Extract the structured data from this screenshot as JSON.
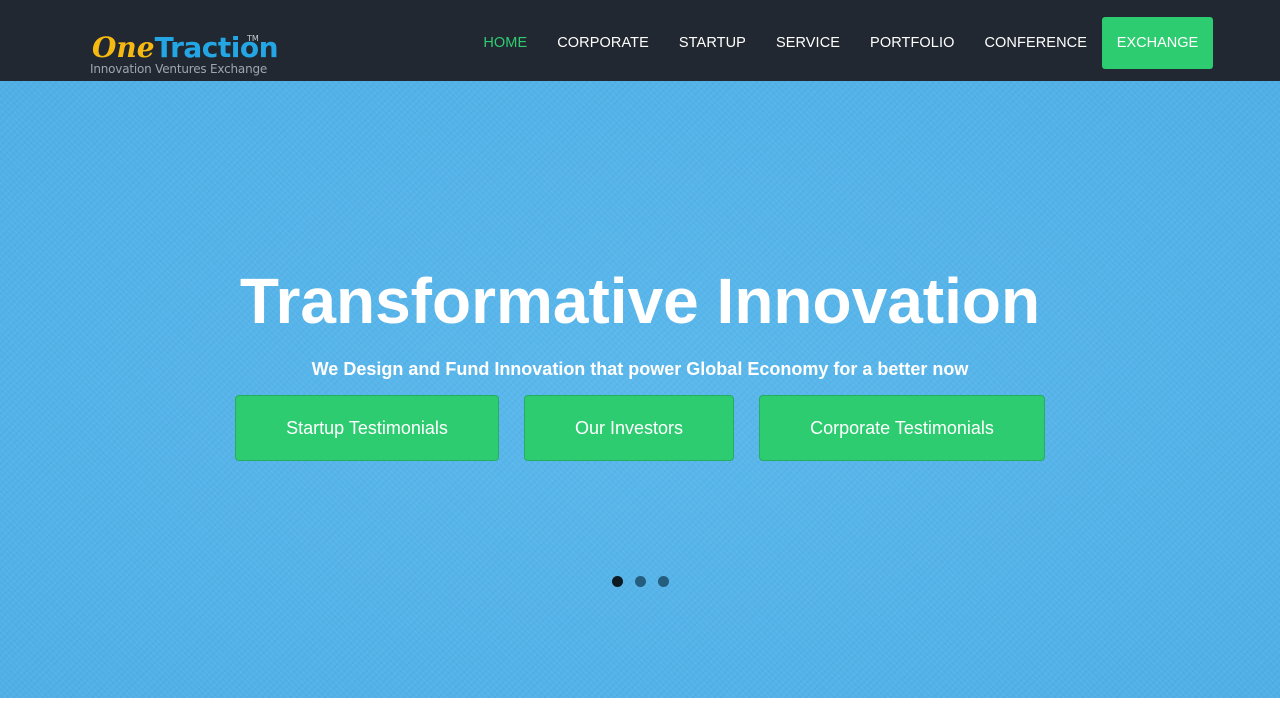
{
  "brand": {
    "logo_part1": "One",
    "logo_part2": "Traction",
    "logo_tm": "TM",
    "tagline": "Innovation Ventures Exchange"
  },
  "nav": {
    "items": [
      {
        "label": "HOME",
        "active": true
      },
      {
        "label": "CORPORATE"
      },
      {
        "label": "STARTUP"
      },
      {
        "label": "SERVICE"
      },
      {
        "label": "PORTFOLIO"
      },
      {
        "label": "CONFERENCE"
      }
    ],
    "cta_label": "EXCHANGE"
  },
  "hero": {
    "title": "Transformative Innovation",
    "subtitle": "We Design and Fund Innovation that power Global Economy for a better now",
    "buttons": [
      {
        "label": "Startup Testimonials"
      },
      {
        "label": "Our Investors"
      },
      {
        "label": "Corporate Testimonials"
      }
    ],
    "carousel": {
      "slide_count": 3,
      "active_index": 0
    }
  },
  "colors": {
    "nav_bg": "#222831",
    "accent_green": "#2ecc71",
    "hero_blue": "#55b4ea",
    "logo_yellow": "#f6b911",
    "logo_blue": "#24a6e4"
  }
}
